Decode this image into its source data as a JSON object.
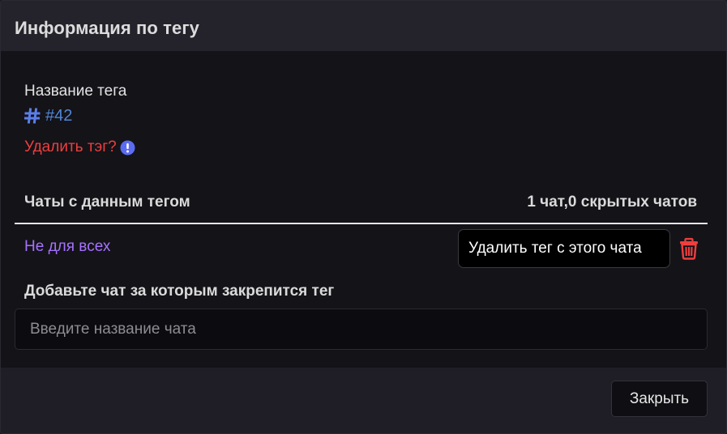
{
  "modal": {
    "title": "Информация по тегу"
  },
  "tag": {
    "name_label": "Название тега",
    "icon": "hash-icon",
    "value": "#42",
    "delete_link": "Удалить тэг?",
    "delete_hint_icon": "info-icon"
  },
  "chats": {
    "header": "Чаты с данным тегом",
    "count_text": "1 чат,0 скрытых чатов",
    "items": [
      {
        "label": "Не для всех"
      }
    ],
    "remove_icon": "trash-icon",
    "remove_tooltip": "Удалить тег с этого чата"
  },
  "add_chat": {
    "label": "Добавьте чат за которым закрепится тег",
    "placeholder": "Введите название чата",
    "value": ""
  },
  "footer": {
    "close_label": "Закрыть"
  },
  "colors": {
    "accent_blue": "#4e86d9",
    "danger_red": "#ef3e3e",
    "chat_purple": "#a672ff",
    "info_icon": "#5b6cf2"
  }
}
